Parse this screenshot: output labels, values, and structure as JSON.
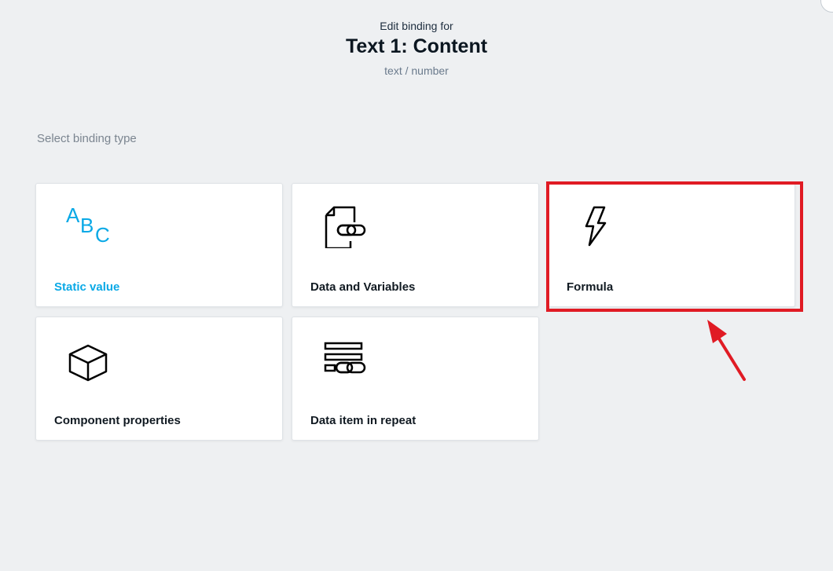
{
  "dialog": {
    "edit_label": "Edit binding for",
    "title": "Text 1: Content",
    "subtitle": "text / number",
    "section_label": "Select binding type"
  },
  "binding_types": [
    {
      "label": "Static value",
      "icon": "abc-text-icon",
      "selected": true
    },
    {
      "label": "Data and Variables",
      "icon": "document-link-icon",
      "selected": false
    },
    {
      "label": "Formula",
      "icon": "lightning-bolt-icon",
      "selected": false
    },
    {
      "label": "Component properties",
      "icon": "cube-icon",
      "selected": false
    },
    {
      "label": "Data item in repeat",
      "icon": "list-link-icon",
      "selected": false
    }
  ],
  "icons": {
    "static_glyph_a": "A",
    "static_glyph_b": "B",
    "static_glyph_c": "C"
  },
  "colors": {
    "accent": "#0aa9e6",
    "highlight": "#e01b24",
    "background": "#eef0f2"
  }
}
